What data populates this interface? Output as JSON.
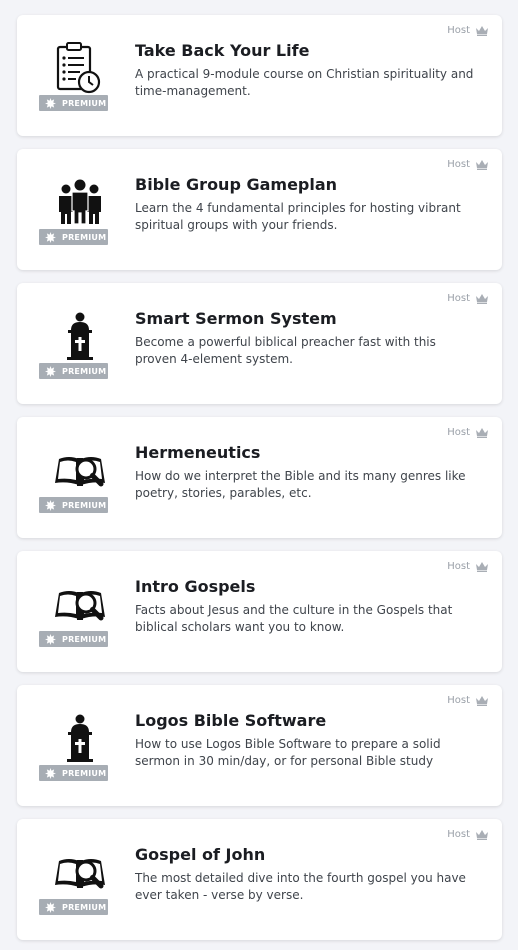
{
  "courses": [
    {
      "icon": "checklist-clock-icon",
      "title": "Take Back Your Life",
      "description": "A practical 9-module course on Christian spirituality and time-management.",
      "host_label": "Host",
      "badge_label": "PREMIUM"
    },
    {
      "icon": "group-people-icon",
      "title": "Bible Group Gameplan",
      "description": "Learn the 4 fundamental principles for hosting vibrant spiritual groups with your friends.",
      "host_label": "Host",
      "badge_label": "PREMIUM"
    },
    {
      "icon": "preacher-pulpit-icon",
      "title": "Smart Sermon System",
      "description": "Become a powerful biblical preacher fast with this proven 4-element system.",
      "host_label": "Host",
      "badge_label": "PREMIUM"
    },
    {
      "icon": "bible-magnifier-icon",
      "title": "Hermeneutics",
      "description": "How do we interpret the Bible and its many genres like poetry, stories, parables, etc.",
      "host_label": "Host",
      "badge_label": "PREMIUM"
    },
    {
      "icon": "bible-magnifier-icon",
      "title": "Intro Gospels",
      "description": "Facts about Jesus and the culture in the Gospels that biblical scholars want you to know.",
      "host_label": "Host",
      "badge_label": "PREMIUM"
    },
    {
      "icon": "preacher-pulpit-icon",
      "title": "Logos Bible Software",
      "description": "How to use Logos Bible Software to prepare a solid sermon in 30 min/day, or for personal Bible study",
      "host_label": "Host",
      "badge_label": "PREMIUM"
    },
    {
      "icon": "bible-magnifier-icon",
      "title": "Gospel of John",
      "description": "The most detailed dive into the fourth gospel you have ever taken - verse by verse.",
      "host_label": "Host",
      "badge_label": "PREMIUM"
    }
  ],
  "colors": {
    "badge_bg": "#a7adb4",
    "host_text": "#9aa0a8",
    "page_bg": "#f3f4f8"
  }
}
